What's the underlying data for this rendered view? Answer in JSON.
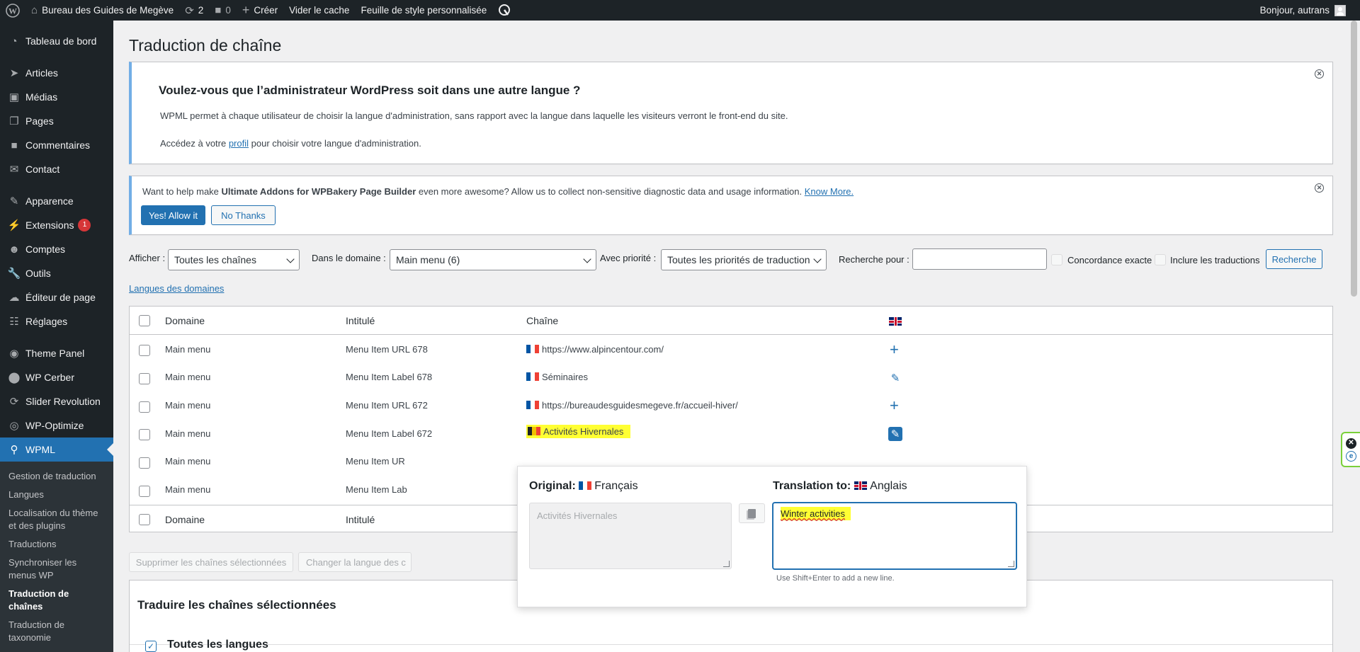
{
  "adminbar": {
    "site_name": "Bureau des Guides de Megève",
    "updates_count": "2",
    "comments_count": "0",
    "create_label": "Créer",
    "clear_cache_label": "Vider le cache",
    "custom_stylesheet_label": "Feuille de style personnalisée",
    "greeting": "Bonjour, autrans"
  },
  "sidebar": {
    "items": [
      {
        "label": "Tableau de bord",
        "icon": "dashboard-icon"
      },
      {
        "label": "Articles",
        "icon": "pin-icon"
      },
      {
        "label": "Médias",
        "icon": "media-icon"
      },
      {
        "label": "Pages",
        "icon": "pages-icon"
      },
      {
        "label": "Commentaires",
        "icon": "comments-icon"
      },
      {
        "label": "Contact",
        "icon": "mail-icon"
      },
      {
        "label": "Apparence",
        "icon": "brush-icon"
      },
      {
        "label": "Extensions",
        "icon": "plugin-icon",
        "badge": "1"
      },
      {
        "label": "Comptes",
        "icon": "users-icon"
      },
      {
        "label": "Outils",
        "icon": "tools-icon"
      },
      {
        "label": "Éditeur de page",
        "icon": "cloud-icon"
      },
      {
        "label": "Réglages",
        "icon": "settings-icon"
      },
      {
        "label": "Theme Panel",
        "icon": "theme-panel-icon"
      },
      {
        "label": "WP Cerber",
        "icon": "cerber-icon"
      },
      {
        "label": "Slider Revolution",
        "icon": "slider-icon"
      },
      {
        "label": "WP-Optimize",
        "icon": "optimize-icon"
      },
      {
        "label": "WPML",
        "icon": "wpml-icon"
      }
    ],
    "submenu": [
      "Gestion de traduction",
      "Langues",
      "Localisation du thème et des plugins",
      "Traductions",
      "Synchroniser les menus WP",
      "Traduction de chaînes",
      "Traduction de taxonomie"
    ]
  },
  "page": {
    "title": "Traduction de chaîne"
  },
  "notice_lang": {
    "title": "Voulez-vous que l’administrateur WordPress soit dans une autre langue ?",
    "p1": "WPML permet à chaque utilisateur de choisir la langue d'administration, sans rapport avec la langue dans laquelle les visiteurs verront le front-end du site.",
    "p2_before": "Accédez à votre ",
    "p2_link": "profil",
    "p2_after": " pour choisir votre langue d'administration."
  },
  "notice_uaa": {
    "text_before": "Want to help make ",
    "text_bold": "Ultimate Addons for WPBakery Page Builder",
    "text_after": " even more awesome? Allow us to collect non-sensitive diagnostic data and usage information. ",
    "link": "Know More.",
    "allow_label": "Yes! Allow it",
    "no_label": "No Thanks"
  },
  "filters": {
    "afficher_label": "Afficher :",
    "afficher_value": "Toutes les chaînes",
    "domaine_label": "Dans le domaine :",
    "domaine_value": "Main menu (6)",
    "priorite_label": "Avec priorité :",
    "priorite_value": "Toutes les priorités de traduction",
    "recherche_label": "Recherche pour :",
    "recherche_value": "",
    "exact_label": "Concordance exacte",
    "include_label": "Inclure les traductions",
    "search_button": "Recherche",
    "domain_langs_link": "Langues des domaines"
  },
  "table": {
    "columns": [
      "Domaine",
      "Intitulé",
      "Chaîne"
    ],
    "rows": [
      {
        "domain": "Main menu",
        "name": "Menu Item URL 678",
        "string": "https://www.alpincentour.com/",
        "action": "add"
      },
      {
        "domain": "Main menu",
        "name": "Menu Item Label 678",
        "string": "Séminaires",
        "action": "edit"
      },
      {
        "domain": "Main menu",
        "name": "Menu Item URL 672",
        "string": "https://bureaudesguidesmegeve.fr/accueil-hiver/",
        "action": "add"
      },
      {
        "domain": "Main menu",
        "name": "Menu Item Label 672",
        "string": "Activités Hivernales",
        "action": "edit-active"
      },
      {
        "domain": "Main menu",
        "name": "Menu Item UR",
        "string": "",
        "action": ""
      },
      {
        "domain": "Main menu",
        "name": "Menu Item Lab",
        "string": "",
        "action": ""
      }
    ],
    "footer": [
      "Domaine",
      "Intitulé"
    ]
  },
  "bulk": {
    "delete_label": "Supprimer les chaînes sélectionnées",
    "change_lang_label": "Changer la langue des c"
  },
  "popup": {
    "original_label": "Original:",
    "original_lang": "Français",
    "original_text": "Activités Hivernales",
    "translation_label": "Translation to:",
    "translation_lang": "Anglais",
    "translation_text": "Winter activities",
    "help": "Use Shift+Enter to add a new line."
  },
  "section": {
    "title": "Traduire les chaînes sélectionnées",
    "all_languages": "Toutes les langues"
  },
  "colors": {
    "accent": "#2271b1",
    "adminbar": "#1d2327",
    "highlight": "#ffff33",
    "badge": "#d63638"
  }
}
